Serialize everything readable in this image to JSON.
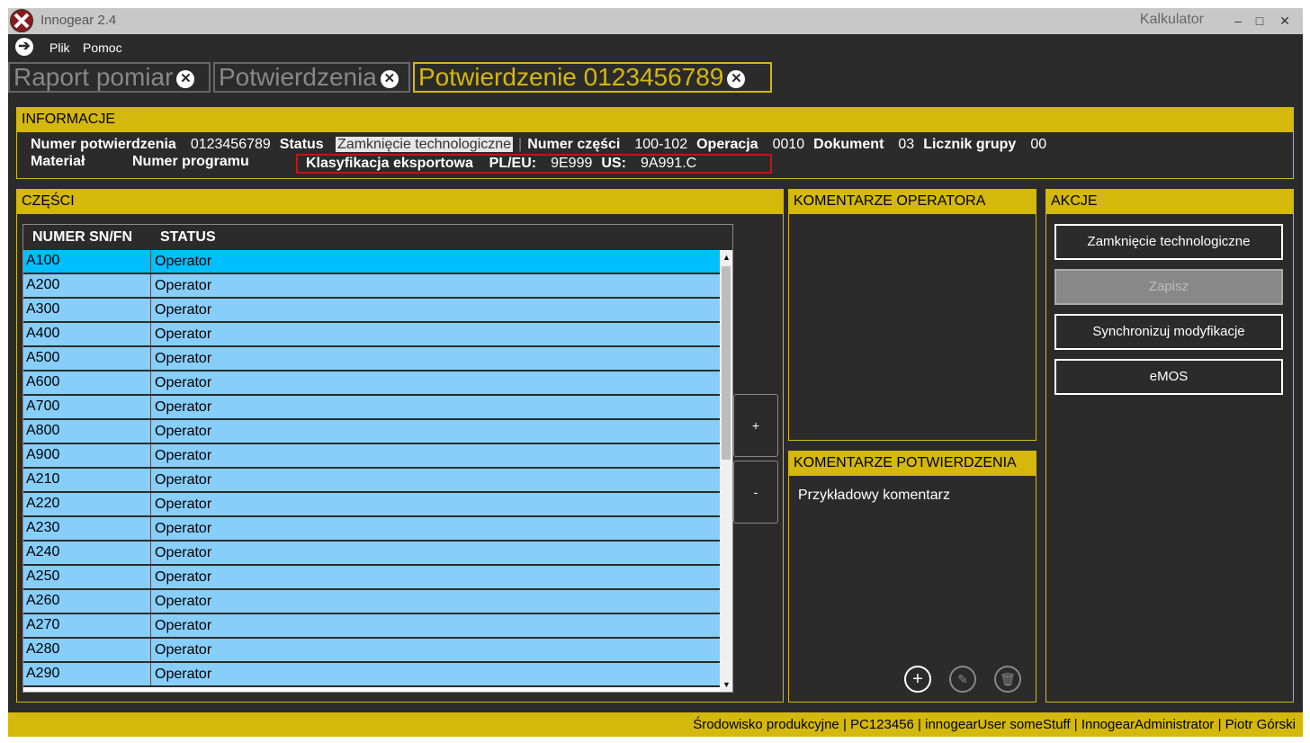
{
  "window": {
    "title": "Innogear 2.4",
    "calc_label": "Kalkulator",
    "minimize": "–",
    "maximize": "□",
    "close": "✕"
  },
  "menu": {
    "items": [
      "Plik",
      "Pomoc"
    ]
  },
  "tabs": [
    "Raport pomiar",
    "Potwierdzenia",
    "Potwierdzenie 0123456789"
  ],
  "info": {
    "title": "INFORMACJE",
    "numer_potwierdzenia_label": "Numer potwierdzenia",
    "numer_potwierdzenia": "0123456789",
    "status_label": "Status",
    "status": "Zamknięcie technologiczne",
    "numer_czesci_label": "Numer części",
    "numer_czesci": "100-102",
    "operacja_label": "Operacja",
    "operacja": "0010",
    "dokument_label": "Dokument",
    "dokument": "03",
    "licznik_label": "Licznik grupy",
    "licznik": "00",
    "material_label": "Materiał",
    "program_label": "Numer programu",
    "klasyfikacja_label": "Klasyfikacja eksportowa",
    "pleu_label": "PL/EU:",
    "pleu": "9E999",
    "us_label": "US:",
    "us": "9A991.C"
  },
  "parts": {
    "title": "CZĘŚCI",
    "col_sn": "NUMER SN/FN",
    "col_status": "STATUS",
    "rows": [
      {
        "sn": "A100",
        "status": "Operator"
      },
      {
        "sn": "A200",
        "status": "Operator"
      },
      {
        "sn": "A300",
        "status": "Operator"
      },
      {
        "sn": "A400",
        "status": "Operator"
      },
      {
        "sn": "A500",
        "status": "Operator"
      },
      {
        "sn": "A600",
        "status": "Operator"
      },
      {
        "sn": "A700",
        "status": "Operator"
      },
      {
        "sn": "A800",
        "status": "Operator"
      },
      {
        "sn": "A900",
        "status": "Operator"
      },
      {
        "sn": "A210",
        "status": "Operator"
      },
      {
        "sn": "A220",
        "status": "Operator"
      },
      {
        "sn": "A230",
        "status": "Operator"
      },
      {
        "sn": "A240",
        "status": "Operator"
      },
      {
        "sn": "A250",
        "status": "Operator"
      },
      {
        "sn": "A260",
        "status": "Operator"
      },
      {
        "sn": "A270",
        "status": "Operator"
      },
      {
        "sn": "A280",
        "status": "Operator"
      },
      {
        "sn": "A290",
        "status": "Operator"
      }
    ],
    "add": "+",
    "remove": "-"
  },
  "operator_comments": {
    "title": "KOMENTARZE OPERATORA"
  },
  "confirmation_comments": {
    "title": "KOMENTARZE POTWIERDZENIA",
    "text": "Przykładowy komentarz"
  },
  "actions": {
    "title": "AKCJE",
    "buttons": [
      "Zamknięcie technologiczne",
      "Zapisz",
      "Synchronizuj modyfikacje",
      "eMOS"
    ]
  },
  "statusbar": {
    "text": "Środowisko produkcyjne | PC123456 | innogearUser someStuff | InnogearAdministrator | Piotr Górski"
  },
  "colors": {
    "accent": "#d4b80c",
    "background": "#2b2b2b",
    "row": "#87cefa",
    "row_selected": "#00bfff"
  }
}
